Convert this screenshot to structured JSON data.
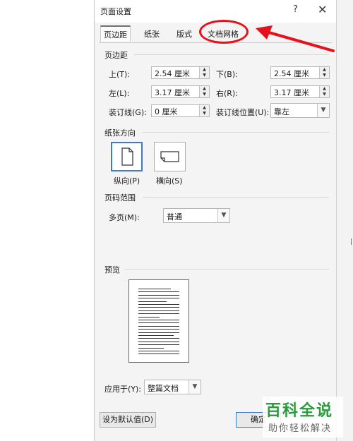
{
  "dialog": {
    "title": "页面设置",
    "help_label": "?",
    "close_label": "✕",
    "tabs": [
      {
        "label": "页边距",
        "active": true
      },
      {
        "label": "纸张",
        "active": false
      },
      {
        "label": "版式",
        "active": false
      },
      {
        "label": "文档网格",
        "active": false
      }
    ],
    "margins": {
      "section_title": "页边距",
      "top": {
        "label": "上(T):",
        "value": "2.54 厘米"
      },
      "bottom": {
        "label": "下(B):",
        "value": "2.54 厘米"
      },
      "left": {
        "label": "左(L):",
        "value": "3.17 厘米"
      },
      "right": {
        "label": "右(R):",
        "value": "3.17 厘米"
      },
      "gutter": {
        "label": "装订线(G):",
        "value": "0 厘米"
      },
      "gutter_position": {
        "label": "装订线位置(U):",
        "value": "靠左"
      }
    },
    "orientation": {
      "section_title": "纸张方向",
      "portrait_label": "纵向(P)",
      "landscape_label": "横向(S)",
      "selected": "portrait"
    },
    "pages": {
      "section_title": "页码范围",
      "multiple_label": "多页(M):",
      "multiple_value": "普通"
    },
    "preview": {
      "section_title": "预览",
      "apply_to_label": "应用于(Y):",
      "apply_to_value": "整篇文档"
    },
    "buttons": {
      "set_default": "设为默认值(D)",
      "ok": "确定"
    }
  },
  "watermark": {
    "title": "百科全说",
    "subtitle": "助你轻松解决"
  },
  "side_mark": "|",
  "colors": {
    "annotation": "#e8101a",
    "selection_border": "#3c7bc6",
    "watermark_green": "#2c9a3c"
  }
}
